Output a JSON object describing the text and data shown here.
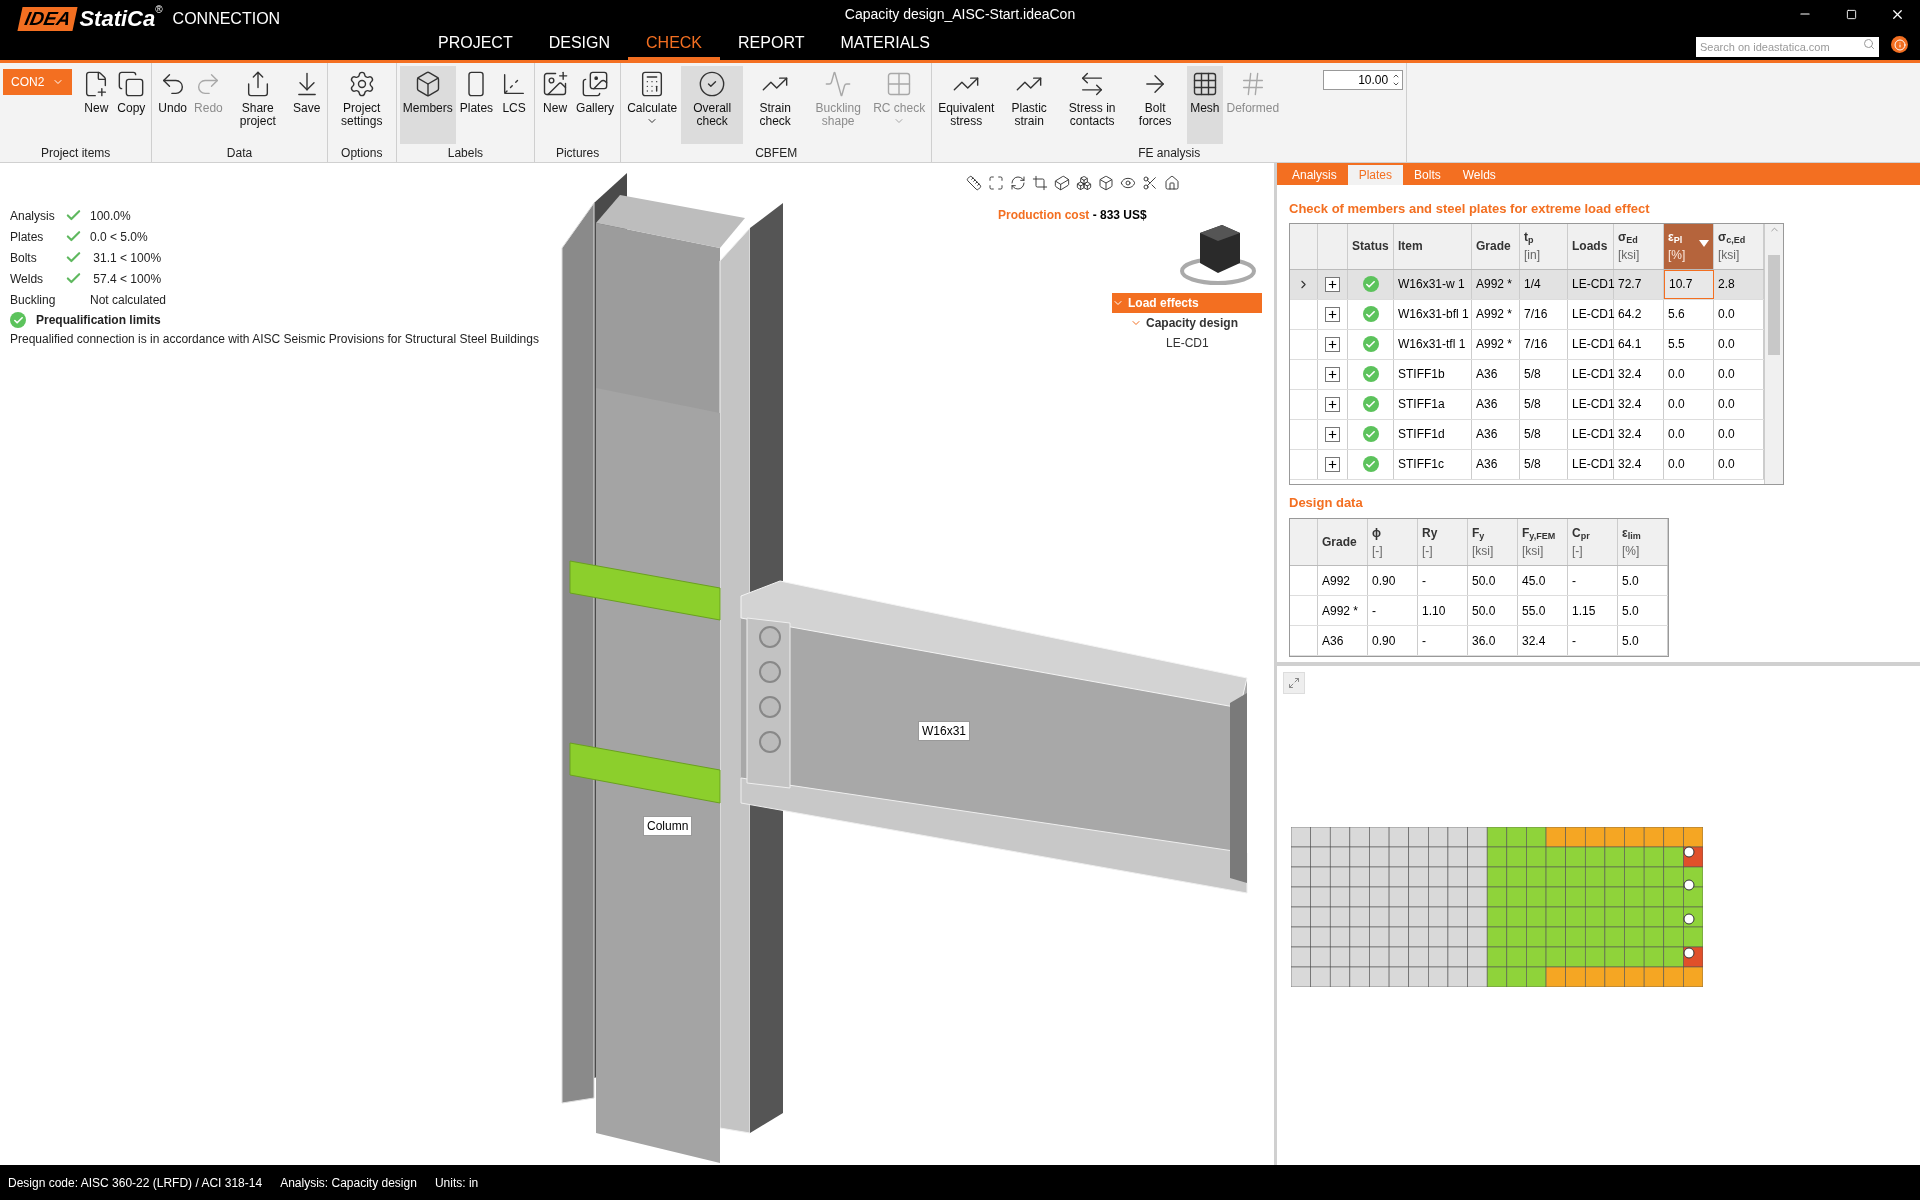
{
  "window": {
    "title": "Capacity design_AISC-Start.ideaCon"
  },
  "logo": {
    "mark": "IDEA",
    "name": "StatiCa",
    "registered": "®",
    "product": "CONNECTION"
  },
  "menu": [
    {
      "label": "PROJECT",
      "selected": false
    },
    {
      "label": "DESIGN",
      "selected": false
    },
    {
      "label": "CHECK",
      "selected": true
    },
    {
      "label": "REPORT",
      "selected": false
    },
    {
      "label": "MATERIALS",
      "selected": false
    }
  ],
  "search": {
    "placeholder": "Search on ideastatica.com"
  },
  "ribbon": {
    "connection": "CON2",
    "mesh_size": "10.00",
    "groups": [
      {
        "label": "Project items",
        "items": [
          {
            "label": "New",
            "selected": false,
            "disabled": false,
            "dropdown": false
          },
          {
            "label": "Copy",
            "selected": false,
            "disabled": false,
            "dropdown": false
          }
        ]
      },
      {
        "label": "Data",
        "items": [
          {
            "label": "Undo",
            "selected": false,
            "disabled": false,
            "dropdown": false
          },
          {
            "label": "Redo",
            "selected": false,
            "disabled": true,
            "dropdown": false
          },
          {
            "label": "Share project",
            "selected": false,
            "disabled": false,
            "dropdown": false
          },
          {
            "label": "Save",
            "selected": false,
            "disabled": false,
            "dropdown": false
          }
        ]
      },
      {
        "label": "Options",
        "items": [
          {
            "label": "Project settings",
            "selected": false,
            "disabled": false,
            "dropdown": false
          }
        ]
      },
      {
        "label": "Labels",
        "items": [
          {
            "label": "Members",
            "selected": true,
            "disabled": false,
            "dropdown": false
          },
          {
            "label": "Plates",
            "selected": false,
            "disabled": false,
            "dropdown": false
          },
          {
            "label": "LCS",
            "selected": false,
            "disabled": false,
            "dropdown": false
          }
        ]
      },
      {
        "label": "Pictures",
        "items": [
          {
            "label": "New",
            "selected": false,
            "disabled": false,
            "dropdown": false
          },
          {
            "label": "Gallery",
            "selected": false,
            "disabled": false,
            "dropdown": false
          }
        ]
      },
      {
        "label": "CBFEM",
        "items": [
          {
            "label": "Calculate",
            "selected": false,
            "disabled": false,
            "dropdown": true
          },
          {
            "label": "Overall check",
            "selected": true,
            "disabled": false,
            "dropdown": false
          },
          {
            "label": "Strain check",
            "selected": false,
            "disabled": false,
            "dropdown": false
          },
          {
            "label": "Buckling shape",
            "selected": false,
            "disabled": true,
            "dropdown": false
          },
          {
            "label": "RC check",
            "selected": false,
            "disabled": true,
            "dropdown": true
          }
        ]
      },
      {
        "label": "FE analysis",
        "items": [
          {
            "label": "Equivalent stress",
            "selected": false,
            "disabled": false,
            "dropdown": false
          },
          {
            "label": "Plastic strain",
            "selected": false,
            "disabled": false,
            "dropdown": false
          },
          {
            "label": "Stress in contacts",
            "selected": false,
            "disabled": false,
            "dropdown": false
          },
          {
            "label": "Bolt forces",
            "selected": false,
            "disabled": false,
            "dropdown": false
          },
          {
            "label": "Mesh",
            "selected": true,
            "disabled": false,
            "dropdown": false
          },
          {
            "label": "Deformed",
            "selected": false,
            "disabled": true,
            "dropdown": false
          }
        ]
      }
    ]
  },
  "summary": {
    "checks": [
      {
        "label": "Analysis",
        "passed": true,
        "value": "100.0%"
      },
      {
        "label": "Plates",
        "passed": true,
        "value": "0.0 < 5.0%"
      },
      {
        "label": "Bolts",
        "passed": true,
        "value": " 31.1 < 100%"
      },
      {
        "label": "Welds",
        "passed": true,
        "value": " 57.4 < 100%"
      },
      {
        "label": "Buckling",
        "passed": false,
        "value": "Not calculated"
      }
    ],
    "prequalification": {
      "title": "Prequalification limits",
      "passed": true,
      "note": "Prequalified connection is in accordance with AISC Seismic Provisions for Structural Steel Buildings"
    }
  },
  "production_cost": {
    "label": "Production cost",
    "value": " - 833 US$"
  },
  "tree": [
    {
      "label": "Load effects",
      "selected": true,
      "expanded": true,
      "children": [
        {
          "label": "Capacity design",
          "selected": false,
          "expanded": true,
          "children": [
            {
              "label": "LE-CD1",
              "selected": false
            }
          ]
        }
      ]
    }
  ],
  "model_labels": {
    "beam": "W16x31",
    "column": "Column"
  },
  "results": {
    "tabs": [
      {
        "label": "Analysis",
        "selected": false
      },
      {
        "label": "Plates",
        "selected": true
      },
      {
        "label": "Bolts",
        "selected": false
      },
      {
        "label": "Welds",
        "selected": false
      }
    ],
    "title": "Check of members and steel plates for extreme load effect",
    "columns": [
      {
        "label": "Status",
        "sorted": false
      },
      {
        "label": "Item",
        "sorted": false
      },
      {
        "label": "Grade",
        "sorted": false
      },
      {
        "label": "t$_{p}$",
        "unit": "[in]",
        "sorted": false
      },
      {
        "label": "Loads",
        "sorted": false
      },
      {
        "label": "σ$_{Ed}$",
        "unit": "[ksi]",
        "sorted": false
      },
      {
        "label": "ε$_{Pl}$",
        "unit": "[%]",
        "sorted": true
      },
      {
        "label": "σ$_{c,Ed}$",
        "unit": "[ksi]",
        "sorted": false
      }
    ],
    "rows": [
      {
        "selected": true,
        "cells": [
          {
            "passed": true
          },
          "W16x31-w 1",
          "A992 *",
          "1/4",
          "LE-CD1",
          "72.7",
          "10.7",
          "2.8"
        ]
      },
      {
        "selected": false,
        "cells": [
          {
            "passed": true
          },
          "W16x31-bfl 1",
          "A992 *",
          "7/16",
          "LE-CD1",
          "64.2",
          "5.6",
          "0.0"
        ]
      },
      {
        "selected": false,
        "cells": [
          {
            "passed": true
          },
          "W16x31-tfl 1",
          "A992 *",
          "7/16",
          "LE-CD1",
          "64.1",
          "5.5",
          "0.0"
        ]
      },
      {
        "selected": false,
        "cells": [
          {
            "passed": true
          },
          "STIFF1b",
          "A36",
          "5/8",
          "LE-CD1",
          "32.4",
          "0.0",
          "0.0"
        ]
      },
      {
        "selected": false,
        "cells": [
          {
            "passed": true
          },
          "STIFF1a",
          "A36",
          "5/8",
          "LE-CD1",
          "32.4",
          "0.0",
          "0.0"
        ]
      },
      {
        "selected": false,
        "cells": [
          {
            "passed": true
          },
          "STIFF1d",
          "A36",
          "5/8",
          "LE-CD1",
          "32.4",
          "0.0",
          "0.0"
        ]
      },
      {
        "selected": false,
        "cells": [
          {
            "passed": true
          },
          "STIFF1c",
          "A36",
          "5/8",
          "LE-CD1",
          "32.4",
          "0.0",
          "0.0"
        ]
      }
    ]
  },
  "design_data": {
    "title": "Design data",
    "columns": [
      {
        "label": "Grade"
      },
      {
        "label": "ϕ",
        "unit": "[-]"
      },
      {
        "label": "Ry",
        "unit": "[-]"
      },
      {
        "label": "F$_{y}$",
        "unit": "[ksi]"
      },
      {
        "label": "F$_{y,FEM}$",
        "unit": "[ksi]"
      },
      {
        "label": "C$_{pr}$",
        "unit": "[-]"
      },
      {
        "label": "ε$_{lim}$",
        "unit": "[%]"
      }
    ],
    "rows": [
      [
        "A992",
        "0.90",
        "-",
        "50.0",
        "45.0",
        "-",
        "5.0"
      ],
      [
        "A992 *",
        "-",
        "1.10",
        "50.0",
        "55.0",
        "1.15",
        "5.0"
      ],
      [
        "A36",
        "0.90",
        "-",
        "36.0",
        "32.4",
        "-",
        "5.0"
      ]
    ]
  },
  "status_bar": [
    "Design code: AISC 360-22 (LRFD) / ACI 318-14",
    "Analysis: Capacity design",
    "Units: in"
  ]
}
